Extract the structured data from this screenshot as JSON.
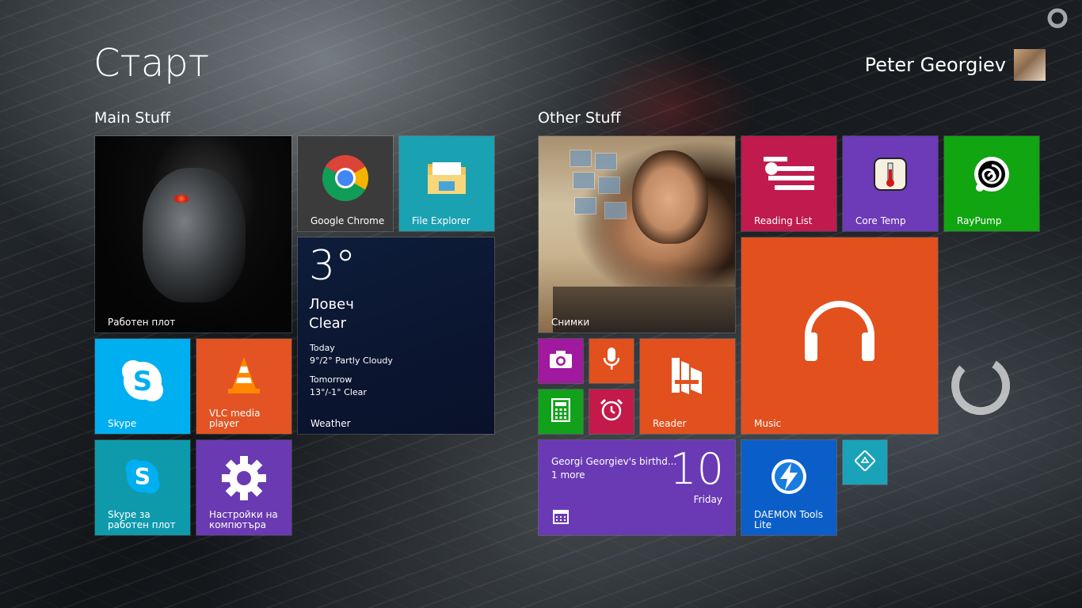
{
  "start": {
    "title": "Старт",
    "user_name": "Peter Georgiev"
  },
  "groups": {
    "main": "Main Stuff",
    "other": "Other Stuff"
  },
  "tiles": {
    "desktop": "Работен плот",
    "chrome": "Google Chrome",
    "file_explorer": "File Explorer",
    "skype": "Skype",
    "vlc": "VLC media player",
    "skype_desktop": "Skype за работен плот",
    "settings": "Настройки на компютъра",
    "photos": "Снимки",
    "reading_list": "Reading List",
    "core_temp": "Core Temp",
    "raypump": "RayPump",
    "reader": "Reader",
    "music": "Music",
    "daemon_tools": "DAEMON Tools Lite"
  },
  "weather": {
    "temp": "3°",
    "city": "Ловеч",
    "condition": "Clear",
    "today_label": "Today",
    "today_forecast": "9°/2° Partly Cloudy",
    "tomorrow_label": "Tomorrow",
    "tomorrow_forecast": "13°/-1° Clear",
    "app_label": "Weather"
  },
  "calendar": {
    "event": "Georgi Georgiev's birthd...",
    "more": "1 more",
    "day": "10",
    "weekday": "Friday"
  },
  "colors": {
    "chrome_tile": "#3b3b3b",
    "file_explorer_tile": "#1aa1b2",
    "skype_tile": "#00aff0",
    "vlc_tile": "#e35323",
    "skype_desktop_tile": "#0f9aac",
    "settings_tile": "#6a3ab2",
    "reading_list_tile": "#c01a4e",
    "core_temp_tile": "#6d3ab8",
    "raypump_tile": "#11a511",
    "camera_tile": "#a0199e",
    "voice_tile": "#e2501e",
    "calculator_tile": "#12a11a",
    "alarms_tile": "#c31a4a",
    "reader_tile": "#e2501e",
    "music_tile": "#e2501e",
    "calendar_tile": "#6a3ab5",
    "daemon_tile": "#0b5ec8",
    "remote_tile": "#1aa3b8"
  }
}
